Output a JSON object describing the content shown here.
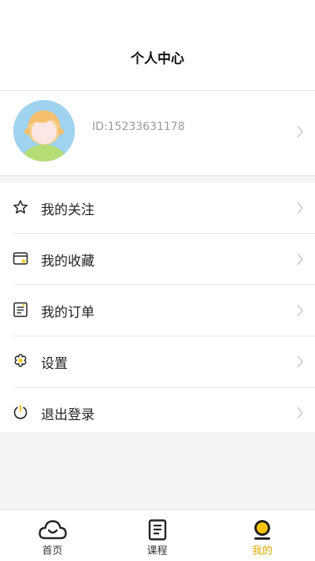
{
  "header": {
    "title": "个人中心"
  },
  "profile": {
    "id_text": "ID:15233631178"
  },
  "menu": {
    "items": [
      {
        "label": "我的关注",
        "icon": "star-icon"
      },
      {
        "label": "我的收藏",
        "icon": "collection-card-icon"
      },
      {
        "label": "我的订单",
        "icon": "order-list-icon"
      },
      {
        "label": "设置",
        "icon": "settings-flower-icon"
      },
      {
        "label": "退出登录",
        "icon": "power-icon"
      }
    ]
  },
  "tabs": [
    {
      "label": "首页",
      "icon": "cloud-smile-icon"
    },
    {
      "label": "课程",
      "icon": "document-icon"
    },
    {
      "label": "我的",
      "icon": "user-dot-icon",
      "active": true
    }
  ],
  "colors": {
    "accent": "#f6c400",
    "active_label": "#e0a800"
  }
}
